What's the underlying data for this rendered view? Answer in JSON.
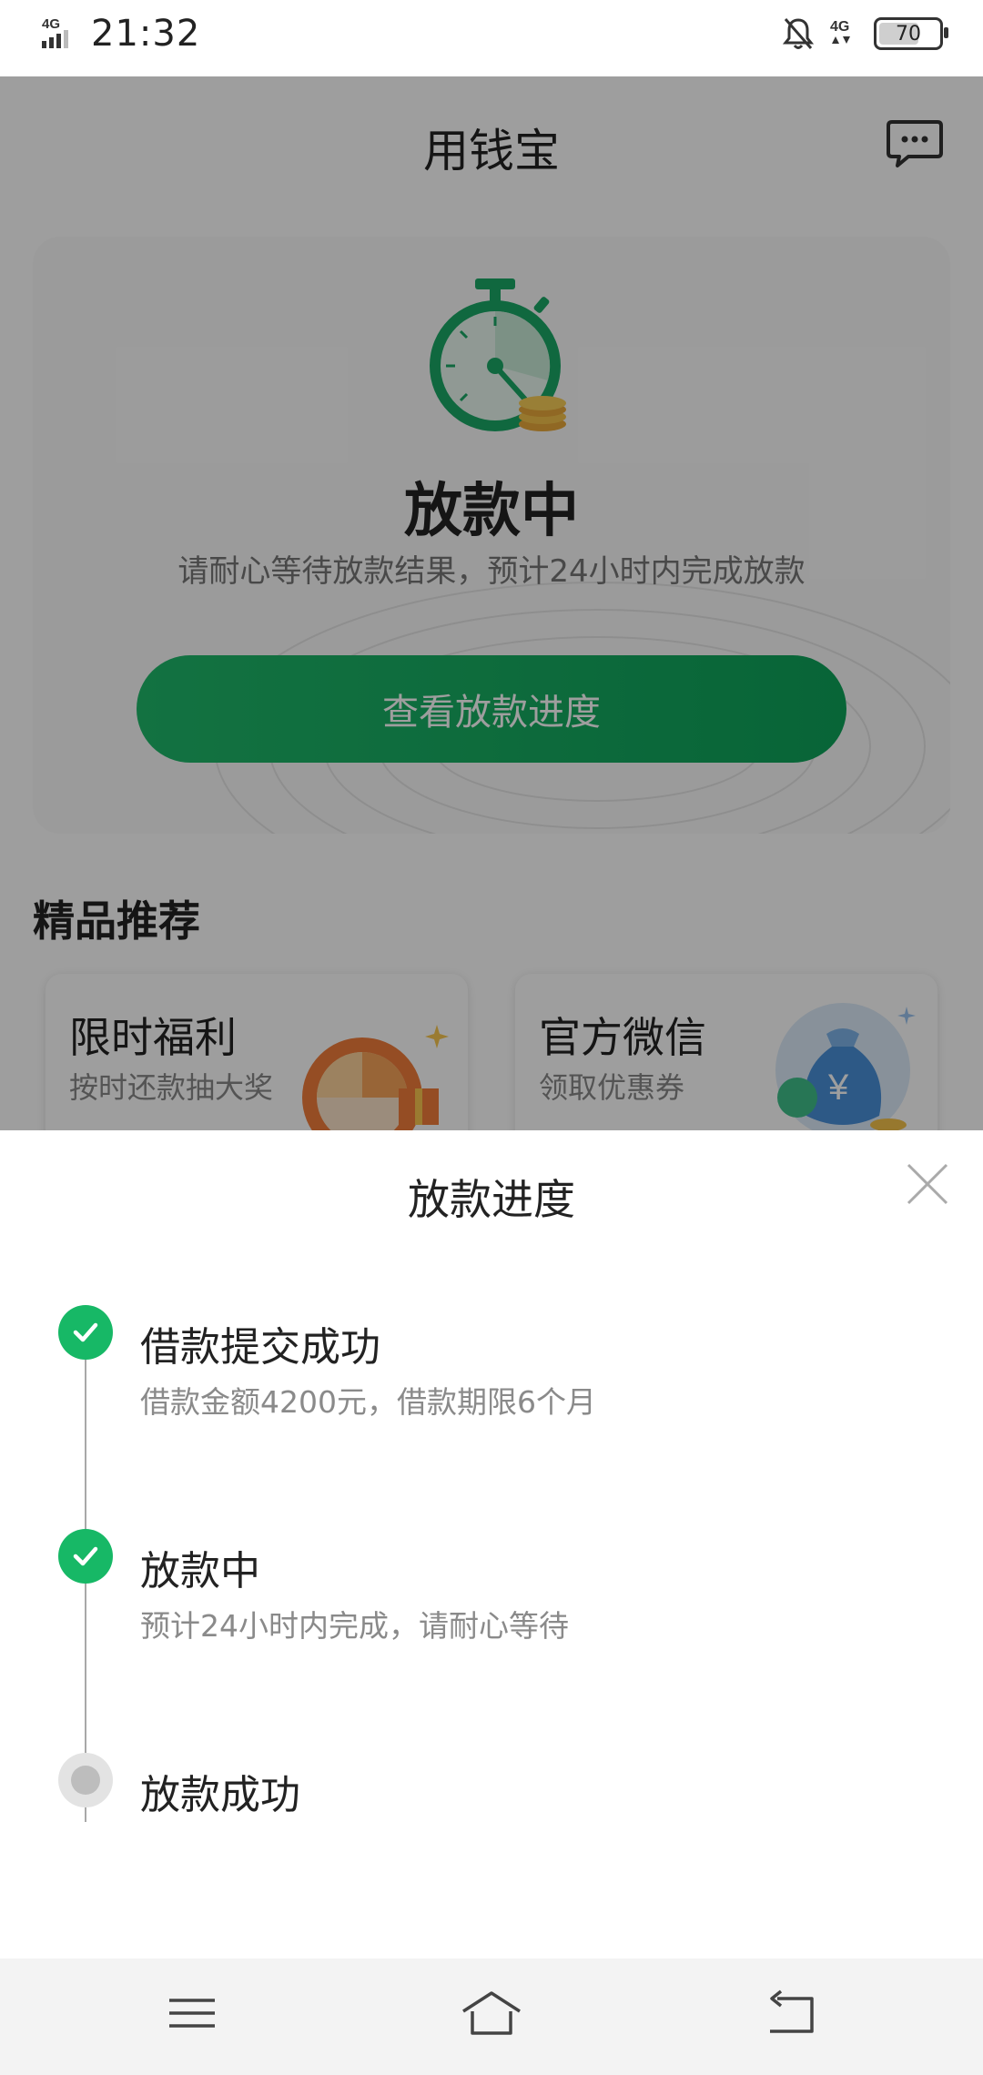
{
  "status_bar": {
    "network": "4G",
    "time": "21:32",
    "network_right": "4G",
    "battery": "70",
    "battery_level_percent": 70
  },
  "page": {
    "title": "用钱宝",
    "status_card": {
      "status": "放款中",
      "description": "请耐心等待放款结果，预计24小时内完成放款",
      "button_label": "查看放款进度"
    },
    "section_title": "精品推荐",
    "promos": [
      {
        "title": "限时福利",
        "subtitle": "按时还款抽大奖"
      },
      {
        "title": "官方微信",
        "subtitle": "领取优惠券"
      }
    ]
  },
  "sheet": {
    "title": "放款进度",
    "steps": [
      {
        "title": "借款提交成功",
        "desc": "借款金额4200元，借款期限6个月",
        "state": "done"
      },
      {
        "title": "放款中",
        "desc": "预计24小时内完成，请耐心等待",
        "state": "done"
      },
      {
        "title": "放款成功",
        "desc": "",
        "state": "pending"
      }
    ]
  },
  "colors": {
    "accent": "#17b866",
    "button_gradient_start": "#1fb86a",
    "button_gradient_end": "#0ea35a"
  },
  "icons": {
    "message": "message-icon",
    "close": "close-icon",
    "menu": "menu-icon",
    "home": "home-icon",
    "back": "back-icon"
  }
}
